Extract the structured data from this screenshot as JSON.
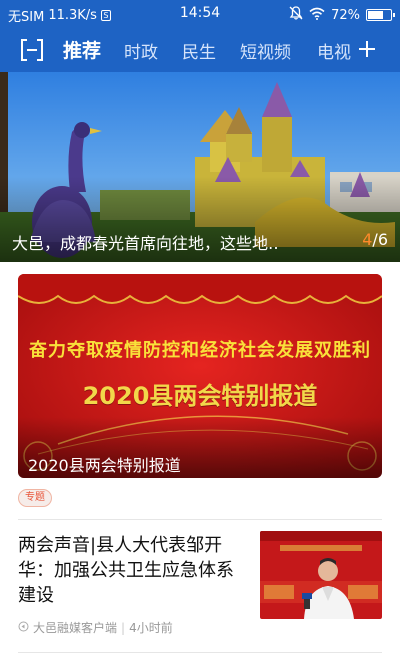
{
  "status_bar": {
    "carrier": "无SIM",
    "speed": "11.3K/s",
    "time": "14:54",
    "battery": "72%",
    "battery_level": 0.72
  },
  "nav": {
    "tabs": [
      {
        "label": "推荐",
        "active": true
      },
      {
        "label": "时政",
        "active": false
      },
      {
        "label": "民生",
        "active": false
      },
      {
        "label": "短视频",
        "active": false
      },
      {
        "label": "电视",
        "active": false
      }
    ]
  },
  "banner": {
    "caption": "大邑，成都春光首席向往地，这些地‥",
    "current": "4",
    "total": "/6"
  },
  "feature": {
    "slogan": "奋力夺取疫情防控和经济社会发展双胜利",
    "headline": "2020县两会特别报道",
    "caption": "2020县两会特别报道",
    "tag": "专题"
  },
  "news_item": {
    "title": "两会声音|县人大代表邹开华：加强公共卫生应急体系建设",
    "source": "大邑融媒客户端",
    "separator": "|",
    "time_ago": "4小时前"
  },
  "colors": {
    "brand_blue": "#1e63c4",
    "counter_orange": "#ff8a2b",
    "tag_red": "#e8553a"
  }
}
